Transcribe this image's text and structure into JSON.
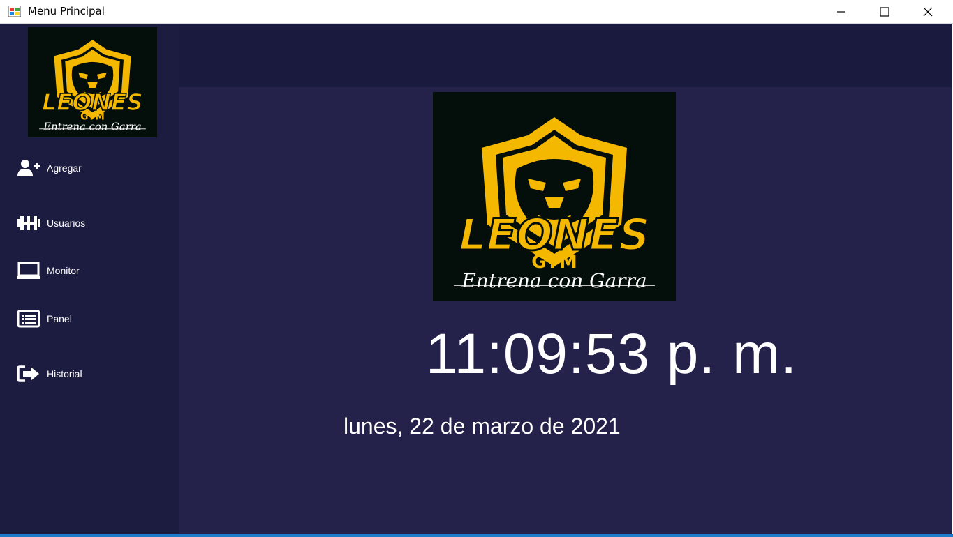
{
  "window": {
    "title": "Menu Principal",
    "controls": {
      "minimize_icon": "minimize-icon",
      "maximize_icon": "maximize-icon",
      "close_icon": "close-icon"
    }
  },
  "brand": {
    "name": "LEONES",
    "sub": "GYM",
    "tagline": "Entrena con Garra",
    "colors": {
      "gold": "#f5b800",
      "logo_bg": "#040f0b"
    }
  },
  "sidebar": {
    "items": [
      {
        "label": "Agregar",
        "icon": "user-plus-icon"
      },
      {
        "label": "Usuarios",
        "icon": "dumbbell-icon"
      },
      {
        "label": "Monitor",
        "icon": "laptop-icon"
      },
      {
        "label": "Panel",
        "icon": "list-icon"
      },
      {
        "label": "Historial",
        "icon": "sign-out-icon"
      }
    ]
  },
  "main": {
    "clock": "11:09:53 p. m.",
    "date": "lunes, 22 de marzo de 2021"
  },
  "colors": {
    "sidebar_bg": "#1c1c41",
    "topbar_bg": "#1a1a3e",
    "main_bg": "#24214a",
    "text": "#ffffff"
  }
}
